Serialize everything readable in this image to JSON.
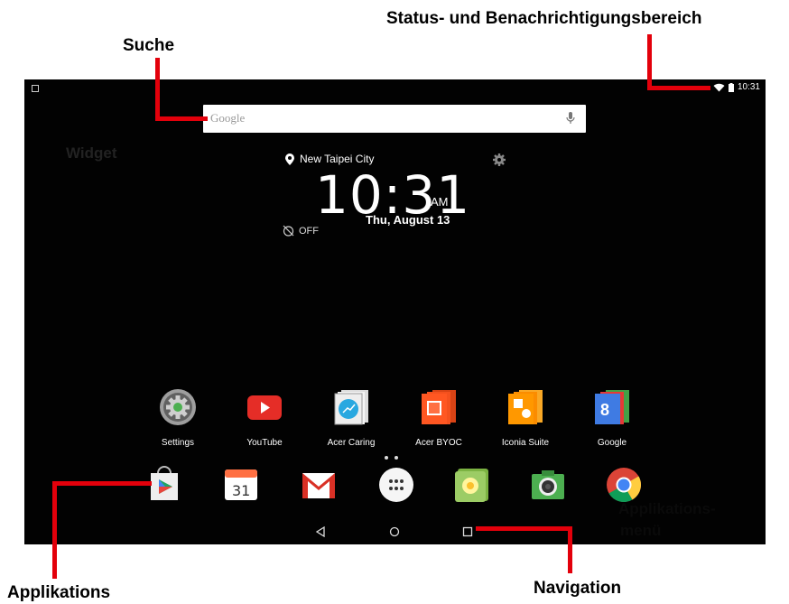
{
  "callouts": {
    "status_area": "Status- und Benachrichtigungsbereich",
    "search": "Suche",
    "applications": "Applikations",
    "navigation": "Navigation",
    "widget": "Widget",
    "app_menu_line1": "Applikations-",
    "app_menu_line2": "menü"
  },
  "status_bar": {
    "time": "10:31",
    "icons": [
      "notification-icon",
      "wifi-icon",
      "battery-icon"
    ]
  },
  "search": {
    "placeholder": "Google",
    "mic_icon": "mic-icon"
  },
  "clock_widget": {
    "location": "New Taipei City",
    "time": "10:31",
    "ampm": "AM",
    "date": "Thu, August 13",
    "alarm": "OFF"
  },
  "apps": [
    {
      "label": "Settings",
      "icon": "settings-icon"
    },
    {
      "label": "YouTube",
      "icon": "youtube-icon"
    },
    {
      "label": "Acer Caring",
      "icon": "acer-caring-icon"
    },
    {
      "label": "Acer BYOC",
      "icon": "acer-byoc-icon"
    },
    {
      "label": "Iconia Suite",
      "icon": "iconia-suite-icon"
    },
    {
      "label": "Google",
      "icon": "google-folder-icon"
    }
  ],
  "dock": [
    "play-store-icon",
    "calendar-icon",
    "gmail-icon",
    "app-drawer-icon",
    "gallery-icon",
    "camera-icon",
    "chrome-icon"
  ],
  "calendar_day": "31",
  "colors": {
    "callout_line": "#e3000b",
    "screen_bg": "#020202",
    "youtube": "#e52d27",
    "gmail": "#d93025"
  }
}
